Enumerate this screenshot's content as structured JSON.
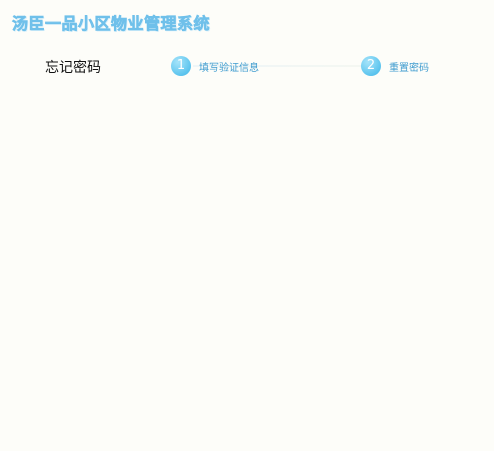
{
  "app": {
    "title": "汤臣一品小区物业管理系统"
  },
  "page": {
    "heading": "忘记密码"
  },
  "steps": [
    {
      "number": "1",
      "label": "填写验证信息"
    },
    {
      "number": "2",
      "label": "重置密码"
    }
  ],
  "colors": {
    "background": "#fdfdf9",
    "title_fill": "#bfe6fb",
    "title_stroke": "#6fc0ea",
    "step_circle": "#5cc4ee",
    "step_label": "#3f9ccf"
  }
}
